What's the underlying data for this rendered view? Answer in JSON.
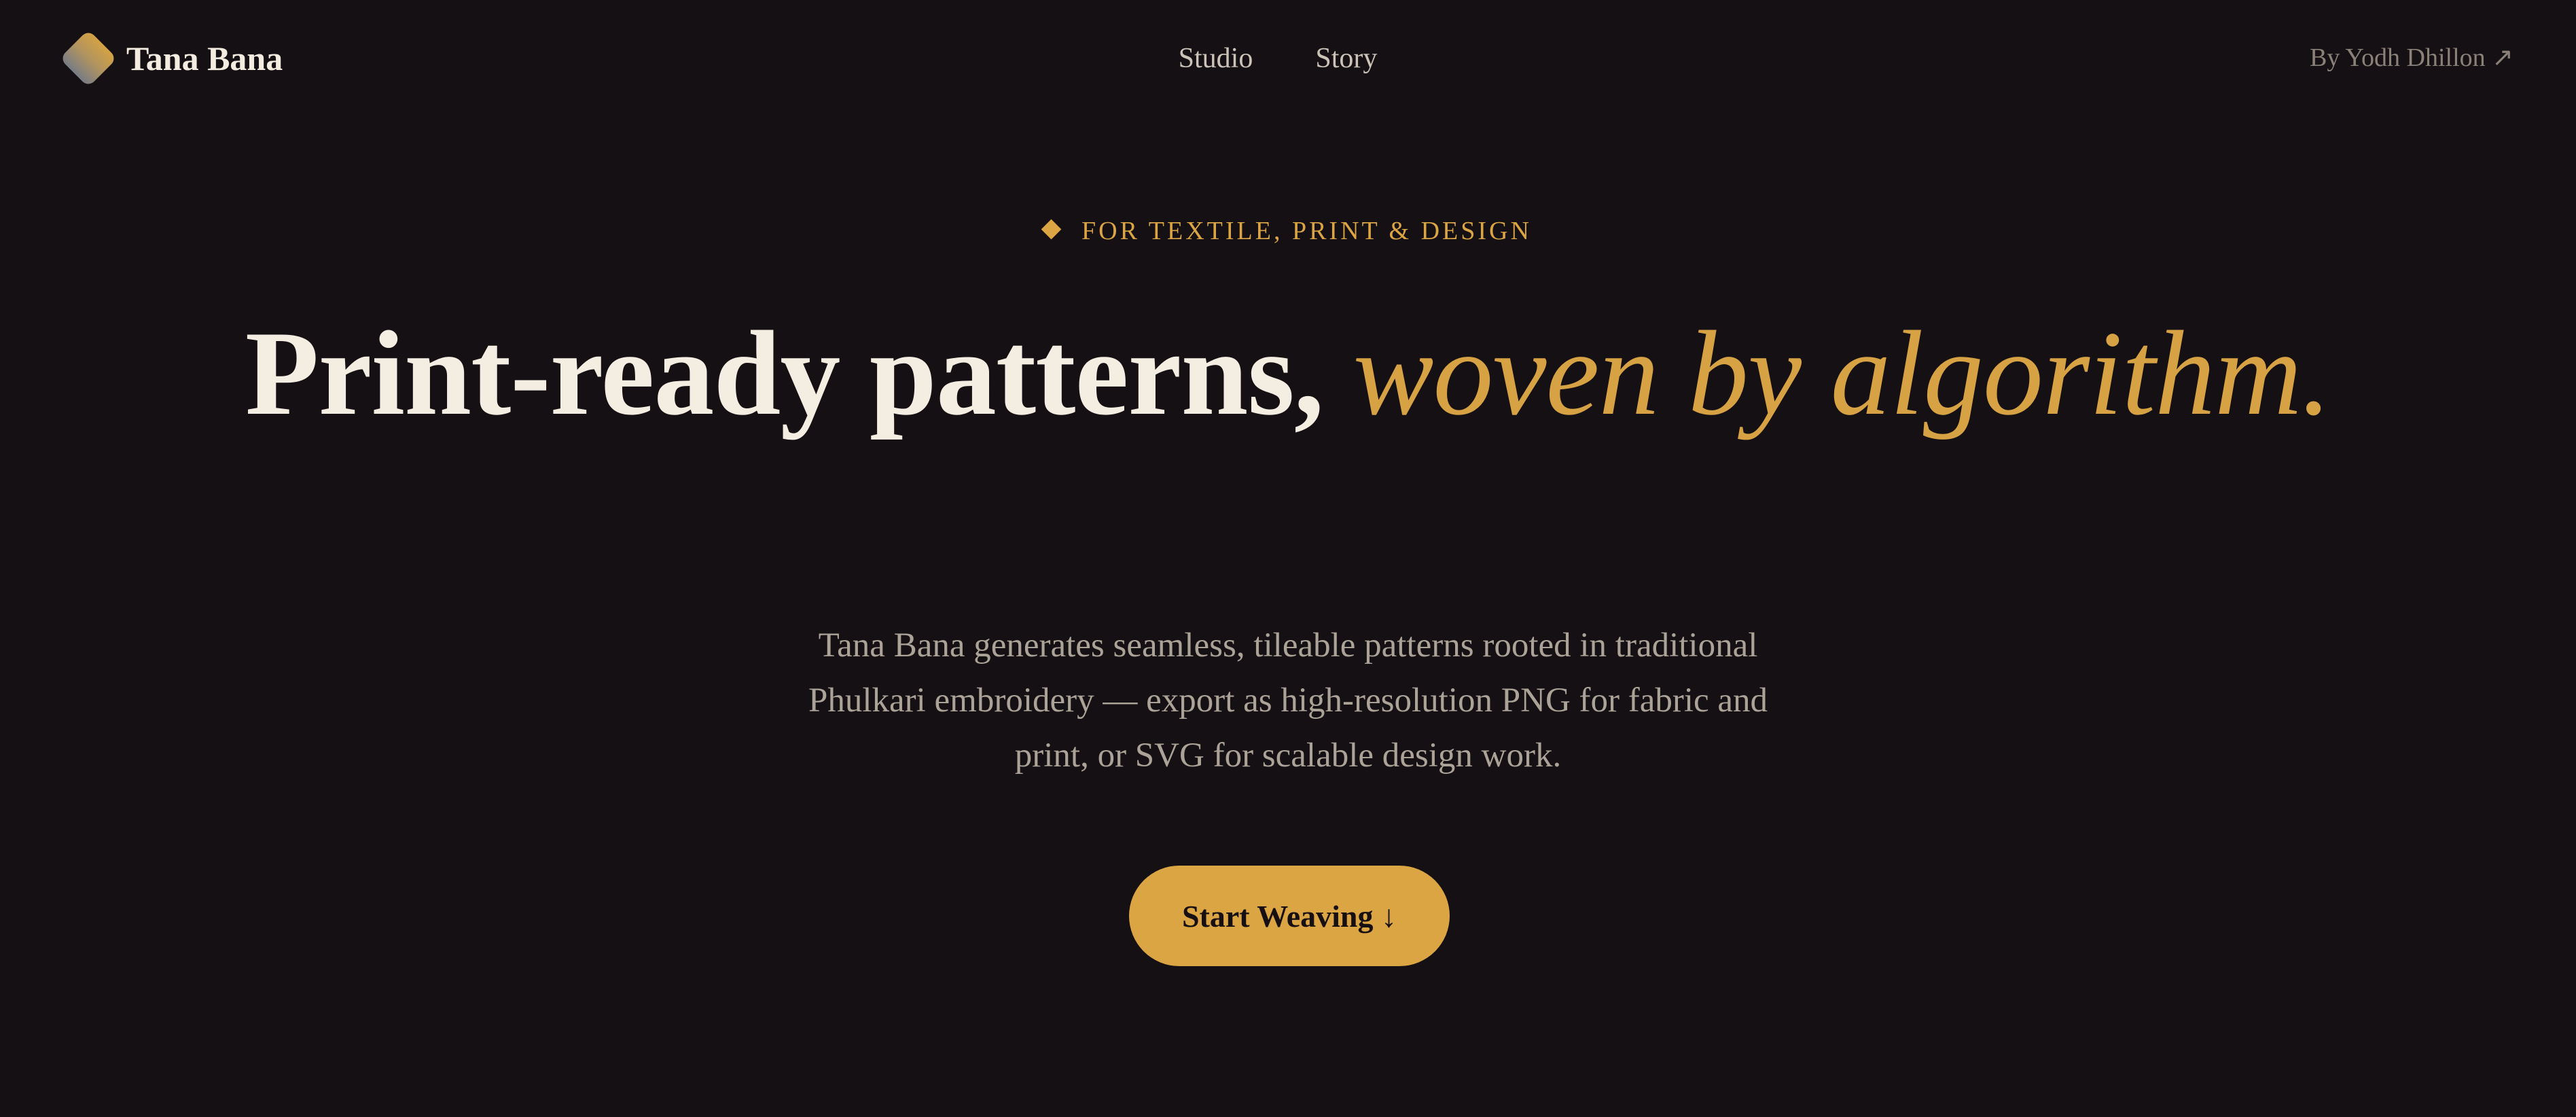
{
  "nav": {
    "brand_name": "Tana Bana",
    "links": [
      {
        "label": "Studio"
      },
      {
        "label": "Story"
      }
    ],
    "author_link": "By Yodh Dhillon ↗"
  },
  "hero": {
    "eyebrow": "FOR TEXTILE, PRINT & DESIGN",
    "headline_plain": "Print-ready patterns,",
    "headline_accent": "woven by algorithm.",
    "description": "Tana Bana generates seamless, tileable patterns rooted in traditional Phulkari embroidery — export as high-resolution PNG for fabric and print, or SVG for scalable design work.",
    "cta_label": "Start Weaving ↓"
  },
  "icons": {
    "brand": "diamond-logo-icon",
    "eyebrow": "diamond-bullet-icon"
  },
  "colors": {
    "background": "#151013",
    "accent_gold": "#dca544",
    "headline_text": "#f3ede2",
    "body_text": "#aca398",
    "muted_text": "#8a8178"
  }
}
